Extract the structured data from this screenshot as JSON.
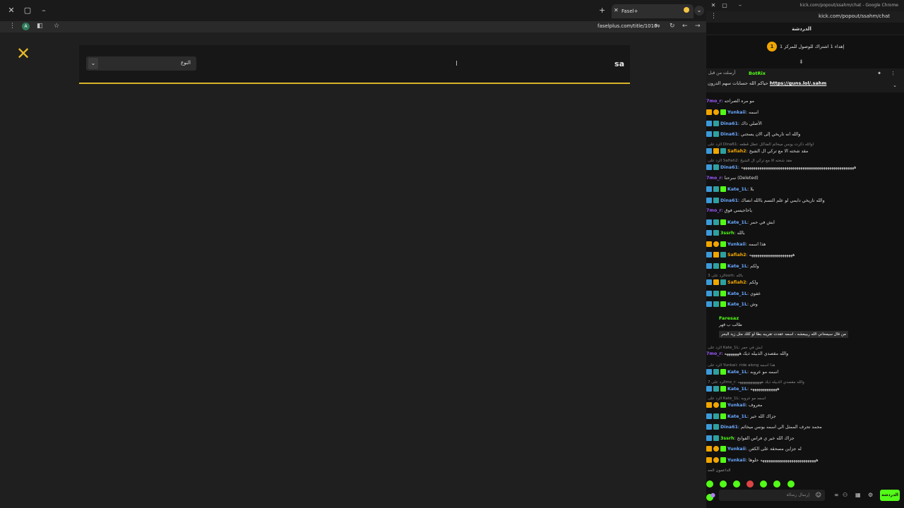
{
  "left_window": {
    "tab_title": "Fasel+",
    "url": "faselplus.com/title/1010",
    "search": {
      "type_label": "النوع",
      "query": "sa"
    }
  },
  "right_window": {
    "title": "kick.com/popout/ssahm/chat - Google Chrome",
    "url": "kick.com/popout/ssahm/chat",
    "header": "الدردشة",
    "goal": {
      "badge": "1",
      "text": "إهداء 1 اشتراك للوصول للمركز 1"
    },
    "pinned": {
      "meta": "أرسلت من قبل",
      "user": "BotRix",
      "text": "حياكم الله حسابات سهم الدرون",
      "link": "https://guns.lol/.sahm"
    },
    "messages": [
      {
        "user": "7mo_r",
        "color": "#9b59ff",
        "text": "مو مره الصراحه",
        "badges": []
      },
      {
        "user": "Yunkaii",
        "color": "#6aa8ff",
        "text": "اسمه",
        "badges": [
          "crown",
          "coin",
          "gift"
        ]
      },
      {
        "user": "Dina61",
        "color": "#6aa8ff",
        "text": "الأصلي ذاك",
        "badges": [
          "kick",
          "sub"
        ]
      },
      {
        "user": "Dina61",
        "color": "#6aa8ff",
        "text": "والله انه تاريخي إلى الان يسجني",
        "badges": [
          "kick",
          "sub"
        ]
      },
      {
        "user": "Safiah2",
        "color": "#f0a500",
        "text": "مقد شخته الا مع تركي ال الشيخ",
        "badges": [
          "kick",
          "crown",
          "sub"
        ],
        "reply": "الرد على Dina61: اوالله ذكرت يونس ميخائم الضاكل عطل قطعه"
      },
      {
        "user": "Dina61",
        "color": "#6aa8ff",
        "text": "هههههههههههههههههههههههههههههههههههههههههههههههههههههههه",
        "badges": [
          "kick",
          "sub"
        ],
        "reply": "الرد على Safiah2: مقد شخته الا مع تركي ال الشيخ"
      },
      {
        "user": "7mo_r",
        "color": "#9b59ff",
        "text": "سرحنا (Deleted)",
        "badges": []
      },
      {
        "user": "Kate_1L",
        "color": "#6aa8ff",
        "text": "بلا",
        "badges": [
          "kick",
          "sub",
          "gift"
        ]
      },
      {
        "user": "Dina61",
        "color": "#6aa8ff",
        "text": "والله تاريخي دايمي لو علم التسم باالله انصاك",
        "badges": [
          "kick",
          "sub"
        ]
      },
      {
        "user": "7mo_r",
        "color": "#9b59ff",
        "text": "ياخاجيسي فوق",
        "badges": []
      },
      {
        "user": "Kate_1L",
        "color": "#6aa8ff",
        "text": "ابش في حمر",
        "badges": [
          "kick",
          "sub",
          "gift"
        ]
      },
      {
        "user": "3ssrh",
        "color": "#53fc18",
        "text": "بالله",
        "badges": [
          "kick",
          "sub"
        ]
      },
      {
        "user": "Yunkaii",
        "color": "#6aa8ff",
        "text": "هذا اسمه",
        "badges": [
          "crown",
          "coin",
          "gift"
        ]
      },
      {
        "user": "Safiah2",
        "color": "#f0a500",
        "text": "هههههههههههههههههههههه",
        "badges": [
          "kick",
          "crown",
          "sub"
        ]
      },
      {
        "user": "Kate_1L",
        "color": "#6aa8ff",
        "text": "ولكم",
        "badges": [
          "kick",
          "sub",
          "gift"
        ]
      },
      {
        "user": "Safiah2",
        "color": "#f0a500",
        "text": "ولكم",
        "badges": [
          "kick",
          "crown",
          "sub"
        ],
        "reply": "الرد على 3ssrh: بالله"
      },
      {
        "user": "Kate_1L",
        "color": "#6aa8ff",
        "text": "عفوي",
        "badges": [
          "kick",
          "sub",
          "gift"
        ]
      },
      {
        "user": "Kate_1L",
        "color": "#6aa8ff",
        "text": "وش",
        "badges": [
          "kick",
          "sub",
          "gift"
        ]
      }
    ],
    "reply_card": {
      "user": "Faresaz",
      "line1": "طالب ب قهر",
      "line2": "من قال سيمحاني الله ربيبعشه ، اسمه عقدت تقريبه بطا لو كلك مثل زيد البحر"
    },
    "messages2": [
      {
        "user": "7mo_r",
        "color": "#9b59ff",
        "text": "والله مقصدي الذبيله ذيك هههههههه",
        "badges": [],
        "reply": "الرد على Kate_1L: ابش في حمر"
      },
      {
        "user": "Kate_1L",
        "color": "#6aa8ff",
        "text": "اسمه مو عروبه",
        "badges": [
          "kick",
          "sub",
          "gift"
        ],
        "reply": "الرد على Yunkaii: ride along هذا اسمه"
      },
      {
        "user": "Kate_1L",
        "color": "#6aa8ff",
        "text": "هههههههههههههه",
        "badges": [
          "kick",
          "sub",
          "gift"
        ],
        "reply": "الرد على 7mo_r: والله مقصدي الذبيله ذيك هههههههههههههه"
      },
      {
        "user": "Yunkaii",
        "color": "#6aa8ff",
        "text": "معروف",
        "badges": [
          "crown",
          "coin",
          "gift"
        ],
        "reply": "الرد على Kate_1L: اسمه مو عروبه"
      },
      {
        "user": "Kate_1L",
        "color": "#6aa8ff",
        "text": "جزاك الله خير",
        "badges": [
          "kick",
          "sub",
          "gift"
        ]
      },
      {
        "user": "Dina61",
        "color": "#6aa8ff",
        "text": "محمد تحرف الممثل الي اسمه يونس ميخائم",
        "badges": [
          "kick",
          "sub"
        ]
      },
      {
        "user": "3ssrh",
        "color": "#53fc18",
        "text": "جزاك الله خير ي فراس الفوانخ",
        "badges": [
          "kick",
          "sub"
        ]
      },
      {
        "user": "Yunkaii",
        "color": "#6aa8ff",
        "text": "له جزاين مسحقة على الكفن",
        "badges": [
          "crown",
          "coin",
          "gift"
        ]
      },
      {
        "user": "Yunkaii",
        "color": "#6aa8ff",
        "text": "هههههههههههههههههههههههههههه حلوها",
        "badges": [
          "crown",
          "coin",
          "gift"
        ]
      }
    ],
    "footer_label": "الداعمون الحه",
    "input_placeholder": "إرسال رسالة",
    "send_label": "الدردشة"
  }
}
